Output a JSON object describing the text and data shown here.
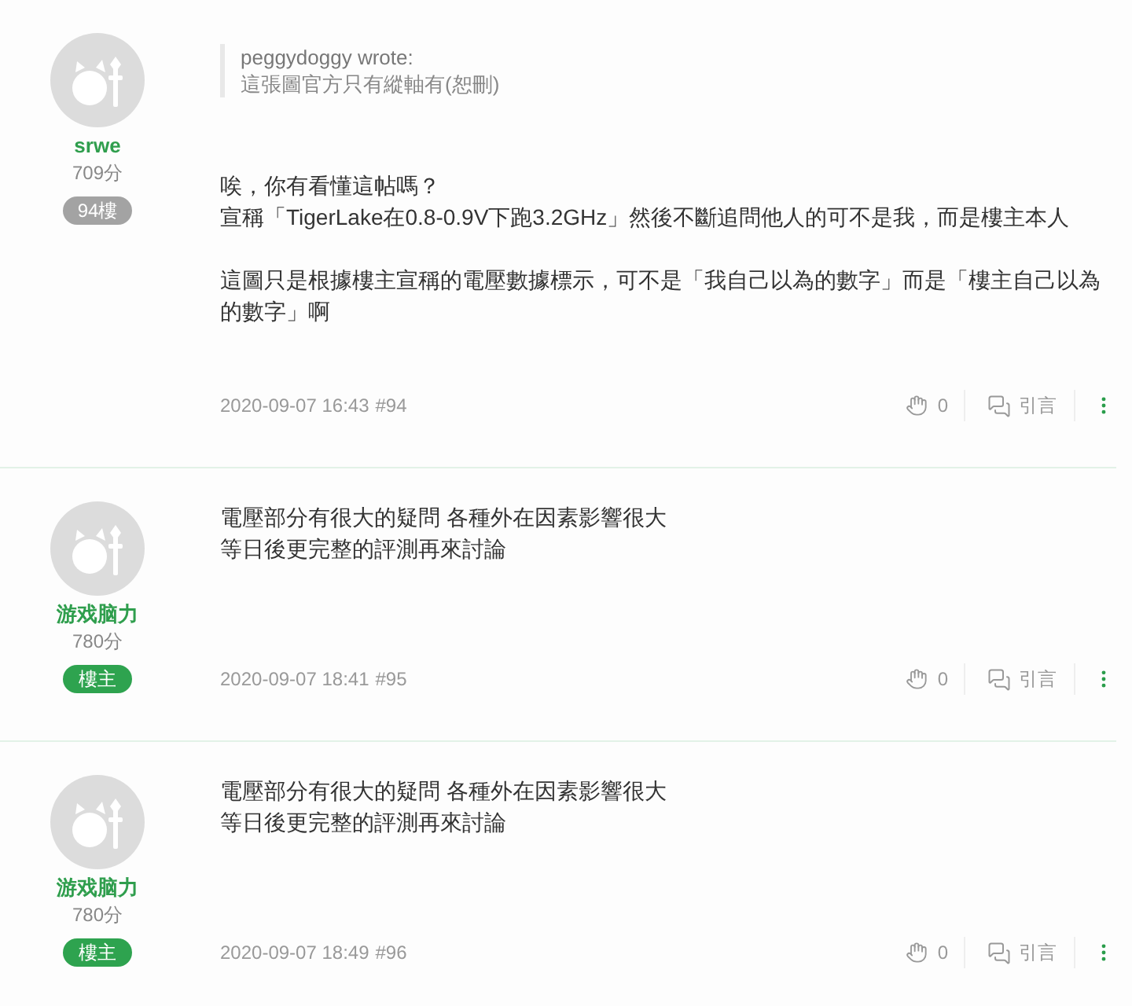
{
  "posts": [
    {
      "user": {
        "name": "srwe",
        "score": "709分",
        "badge": {
          "kind": "floor",
          "label": "94樓"
        }
      },
      "quote": {
        "author_line": "peggydoggy wrote:",
        "text": "這張圖官方只有縱軸有(恕刪)"
      },
      "paragraphs": [
        [
          "唉，你有看懂這帖嗎？",
          "宣稱「TigerLake在0.8-0.9V下跑3.2GHz」然後不斷追問他人的可不是我，而是樓主本人"
        ],
        [
          "這圖只是根據樓主宣稱的電壓數據標示，可不是「我自己以為的數字」而是「樓主自己以為的數字」啊"
        ]
      ],
      "timestamp": "2020-09-07 16:43",
      "post_number": "#94",
      "clap_count": "0",
      "quote_label": "引言"
    },
    {
      "user": {
        "name": "游戏脑力",
        "score": "780分",
        "badge": {
          "kind": "op",
          "label": "樓主"
        }
      },
      "paragraphs": [
        [
          "電壓部分有很大的疑問 各種外在因素影響很大",
          "等日後更完整的評測再來討論"
        ]
      ],
      "timestamp": "2020-09-07 18:41",
      "post_number": "#95",
      "clap_count": "0",
      "quote_label": "引言"
    },
    {
      "user": {
        "name": "游戏脑力",
        "score": "780分",
        "badge": {
          "kind": "op",
          "label": "樓主"
        }
      },
      "paragraphs": [
        [
          "電壓部分有很大的疑問 各種外在因素影響很大",
          "等日後更完整的評測再來討論"
        ]
      ],
      "timestamp": "2020-09-07 18:49",
      "post_number": "#96",
      "clap_count": "0",
      "quote_label": "引言"
    }
  ]
}
